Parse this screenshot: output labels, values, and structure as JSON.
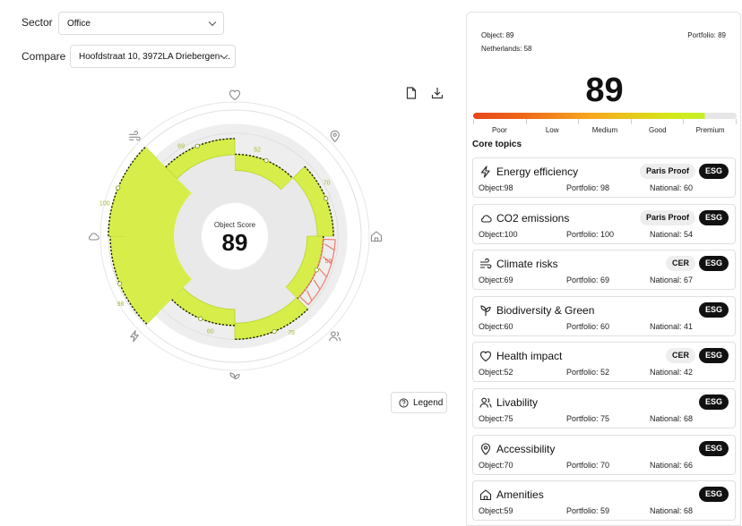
{
  "filters": {
    "sector_label": "Sector",
    "sector_value": "Office",
    "compare_label": "Compare",
    "compare_value": "Hoofdstraat 10, 3972LA Driebergen-..."
  },
  "toolbar": {
    "icons": [
      "file-icon",
      "download-icon"
    ]
  },
  "radar": {
    "center_label": "Object Score",
    "center_value": "89",
    "legend_button": "Legend",
    "segments": [
      {
        "topic": "Health impact",
        "icon": "heart-icon",
        "object": 52,
        "label": "52"
      },
      {
        "topic": "Accessibility",
        "icon": "location-pin-icon",
        "object": 70,
        "label": "70"
      },
      {
        "topic": "Amenities",
        "icon": "home-icon",
        "object": 59,
        "label": "59"
      },
      {
        "topic": "Livability",
        "icon": "users-icon",
        "object": 75,
        "label": "75"
      },
      {
        "topic": "Biodiversity & Green",
        "icon": "plant-icon",
        "object": 60,
        "label": "60"
      },
      {
        "topic": "Energy efficiency",
        "icon": "lightning-icon",
        "object": 98,
        "label": "98"
      },
      {
        "topic": "CO2 emissions",
        "icon": "cloud-icon",
        "object": 100,
        "label": "100"
      },
      {
        "topic": "Climate risks",
        "icon": "wind-icon",
        "object": 69,
        "label": "69"
      }
    ],
    "colors": {
      "object_fill": "#d7ee4a",
      "deficit": "#f07a6a",
      "ring": "#e0e0e0",
      "inner": "#eeeeee"
    }
  },
  "panel": {
    "object_text": "Object: 89",
    "national_text": "Netherlands: 58",
    "portfolio_text": "Portfolio: 89",
    "score": "89",
    "score_fraction": 0.89,
    "scale": [
      "Poor",
      "Low",
      "Medium",
      "Good",
      "Premium"
    ],
    "core_topics_title": "Core topics",
    "topics": [
      {
        "name": "Energy efficiency",
        "icon": "lightning-icon",
        "badges": [
          "Paris Proof"
        ],
        "esg": "ESG",
        "object": "Object:98",
        "portfolio": "Portfolio: 98",
        "national": "National: 60"
      },
      {
        "name": "CO2 emissions",
        "icon": "cloud-icon",
        "badges": [
          "Paris Proof"
        ],
        "esg": "ESG",
        "object": "Object:100",
        "portfolio": "Portfolio: 100",
        "national": "National: 54"
      },
      {
        "name": "Climate risks",
        "icon": "wind-icon",
        "badges": [
          "CER"
        ],
        "esg": "ESG",
        "object": "Object:69",
        "portfolio": "Portfolio: 69",
        "national": "National: 67"
      },
      {
        "name": "Biodiversity & Green",
        "icon": "plant-icon",
        "badges": [],
        "esg": "ESG",
        "object": "Object:60",
        "portfolio": "Portfolio: 60",
        "national": "National: 41"
      },
      {
        "name": "Health impact",
        "icon": "heart-icon",
        "badges": [
          "CER"
        ],
        "esg": "ESG",
        "object": "Object:52",
        "portfolio": "Portfolio: 52",
        "national": "National: 42"
      },
      {
        "name": "Livability",
        "icon": "users-icon",
        "badges": [],
        "esg": "ESG",
        "object": "Object:75",
        "portfolio": "Portfolio: 75",
        "national": "National: 68"
      },
      {
        "name": "Accessibility",
        "icon": "location-pin-icon",
        "badges": [],
        "esg": "ESG",
        "object": "Object:70",
        "portfolio": "Portfolio: 70",
        "national": "National: 66"
      },
      {
        "name": "Amenities",
        "icon": "home-icon",
        "badges": [],
        "esg": "ESG",
        "object": "Object:59",
        "portfolio": "Portfolio: 59",
        "national": "National: 68"
      }
    ]
  }
}
